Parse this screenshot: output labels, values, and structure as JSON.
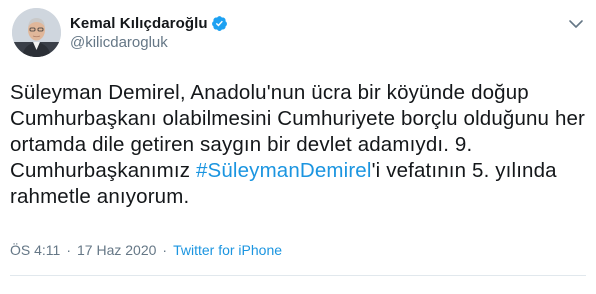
{
  "author": {
    "display_name": "Kemal Kılıçdaroğlu",
    "handle": "@kilicdarogluk",
    "verified_icon": "verified-badge-icon",
    "verified_color": "#1da1f2",
    "avatar_icon": "avatar-photo"
  },
  "tweet": {
    "text_before": "Süleyman Demirel, Anadolu'nun ücra bir köyünde doğup Cumhurbaşkanı olabilmesini Cumhuriyete borçlu olduğunu her ortamda dile getiren saygın bir devlet adamıydı. 9. Cumhurbaşkanımız ",
    "hashtag": "#SüleymanDemirel",
    "text_after": "'i vefatının 5. yılında rahmetle anıyorum.",
    "hashtag_color": "#1b95e0"
  },
  "meta": {
    "time": "ÖS 4:11",
    "separator1": "·",
    "date": "17 Haz 2020",
    "separator2": "·",
    "source": "Twitter for iPhone"
  },
  "menu_icon": "chevron-down-icon"
}
